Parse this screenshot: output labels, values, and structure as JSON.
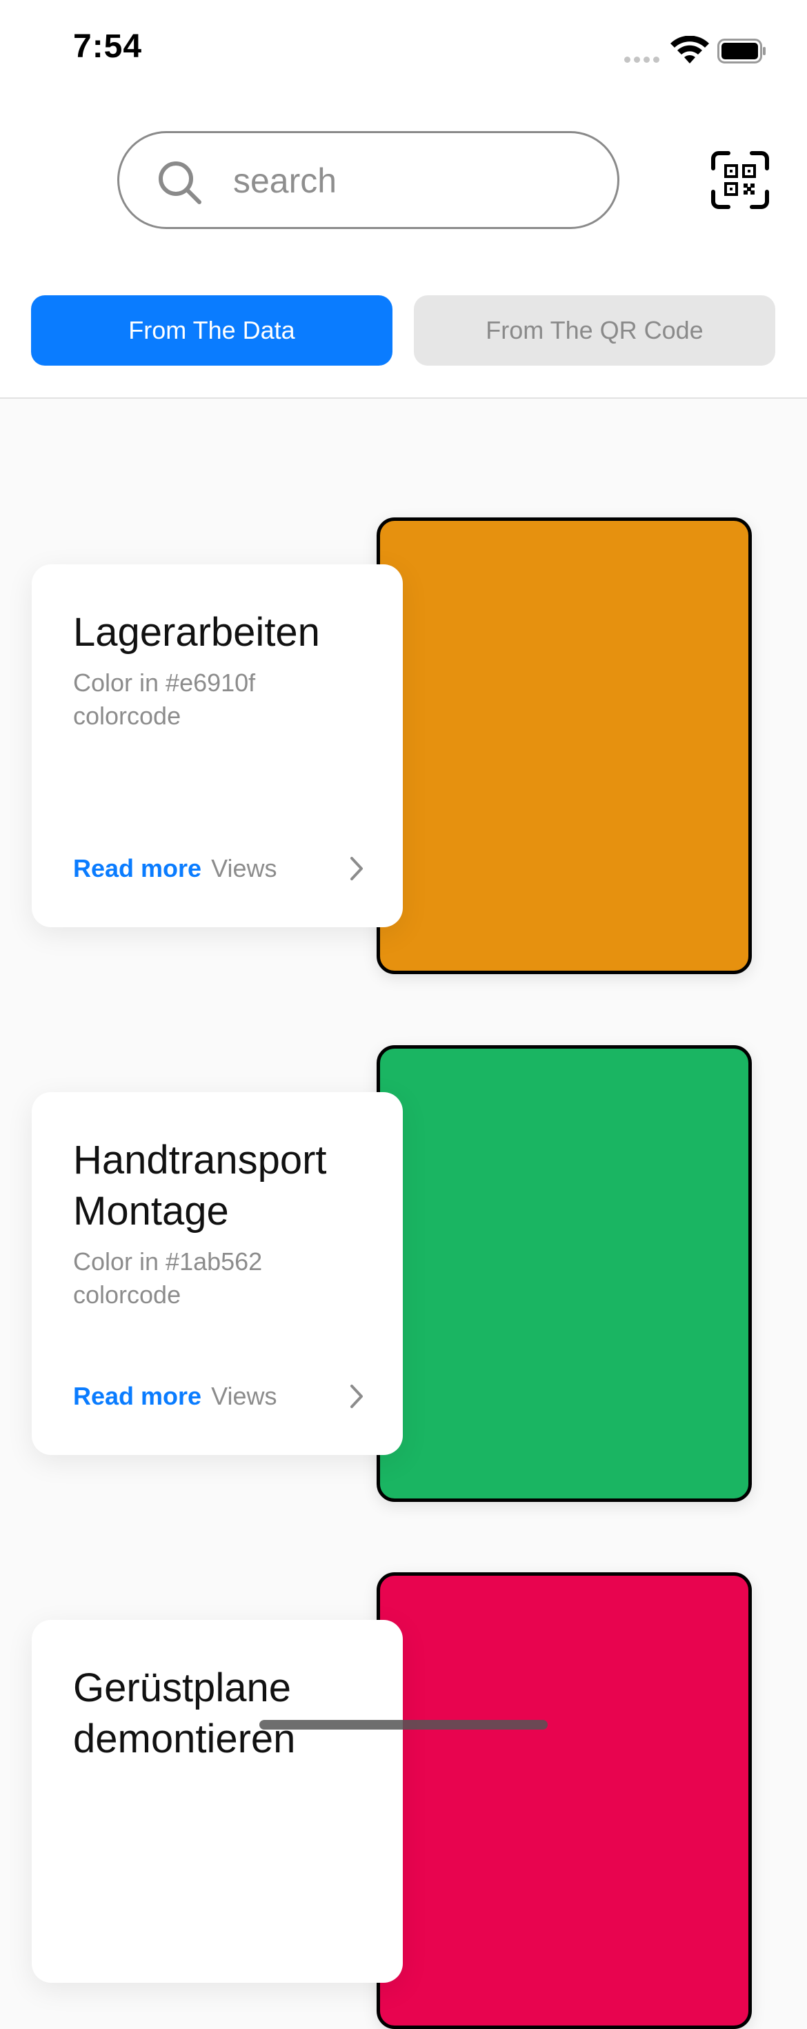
{
  "status_bar": {
    "time": "7:54"
  },
  "search": {
    "placeholder": "search",
    "value": ""
  },
  "icons": {
    "search": "search-icon",
    "qr": "qr-code-scan-icon",
    "chevron": "chevron-right-icon"
  },
  "tabs": [
    {
      "label": "From The Data",
      "active": true
    },
    {
      "label": "From The QR Code",
      "active": false
    }
  ],
  "colors": {
    "accent": "#0a7cff",
    "inactive_tab": "#e6e6e6"
  },
  "items": [
    {
      "title": "Lagerarbeiten",
      "description": "Color in #e6910f colorcode",
      "swatch_color": "#e6910f",
      "read_more_label": "Read more",
      "views_label": "Views"
    },
    {
      "title": "Handtransport Montage",
      "description": "Color in #1ab562 colorcode",
      "swatch_color": "#1ab562",
      "read_more_label": "Read more",
      "views_label": "Views"
    },
    {
      "title": "Gerüstplane demontieren",
      "description": "",
      "swatch_color": "#e8044f",
      "read_more_label": "",
      "views_label": ""
    }
  ]
}
